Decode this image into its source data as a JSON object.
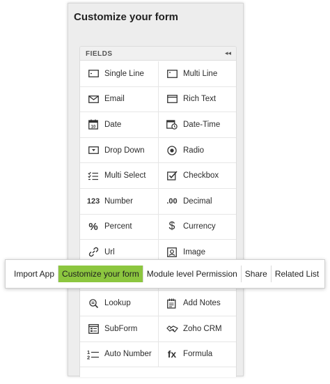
{
  "panel": {
    "title": "Customize your form",
    "section_label": "FIELDS",
    "collapse_glyph": "◂◂"
  },
  "fields": [
    {
      "label": "Single Line",
      "icon": "single-line-icon"
    },
    {
      "label": "Multi Line",
      "icon": "multi-line-icon"
    },
    {
      "label": "Email",
      "icon": "email-icon"
    },
    {
      "label": "Rich Text",
      "icon": "rich-text-icon"
    },
    {
      "label": "Date",
      "icon": "date-icon",
      "glyph": "10"
    },
    {
      "label": "Date-Time",
      "icon": "date-time-icon"
    },
    {
      "label": "Drop Down",
      "icon": "drop-down-icon"
    },
    {
      "label": "Radio",
      "icon": "radio-icon"
    },
    {
      "label": "Multi Select",
      "icon": "multi-select-icon"
    },
    {
      "label": "Checkbox",
      "icon": "checkbox-icon"
    },
    {
      "label": "Number",
      "icon": "number-icon",
      "glyph": "123"
    },
    {
      "label": "Decimal",
      "icon": "decimal-icon",
      "glyph": ".00"
    },
    {
      "label": "Percent",
      "icon": "percent-icon",
      "glyph": "%"
    },
    {
      "label": "Currency",
      "icon": "currency-icon",
      "glyph": "$"
    },
    {
      "label": "Url",
      "icon": "url-icon"
    },
    {
      "label": "Image",
      "icon": "image-icon"
    },
    {
      "label": "",
      "icon": ""
    },
    {
      "label": "",
      "icon": ""
    },
    {
      "label": "Lookup",
      "icon": "lookup-icon"
    },
    {
      "label": "Add Notes",
      "icon": "add-notes-icon"
    },
    {
      "label": "SubForm",
      "icon": "subform-icon"
    },
    {
      "label": "Zoho CRM",
      "icon": "zoho-crm-icon"
    },
    {
      "label": "Auto Number",
      "icon": "auto-number-icon"
    },
    {
      "label": "Formula",
      "icon": "formula-icon",
      "glyph": "fx"
    }
  ],
  "tabs": [
    {
      "label": "Import App",
      "active": false
    },
    {
      "label": "Customize your form",
      "active": true
    },
    {
      "label": "Module level Permission",
      "active": false
    },
    {
      "label": "Share",
      "active": false
    },
    {
      "label": "Related List",
      "active": false
    }
  ],
  "colors": {
    "active_tab": "#8cc63f",
    "panel_bg": "#ededed"
  }
}
